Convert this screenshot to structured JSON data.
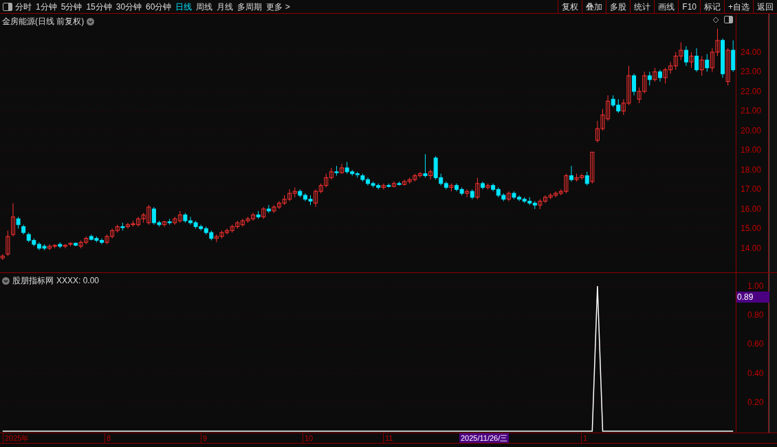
{
  "toolbar": {
    "periods": [
      {
        "label": "分时",
        "selected": false
      },
      {
        "label": "1分钟",
        "selected": false
      },
      {
        "label": "5分钟",
        "selected": false
      },
      {
        "label": "15分钟",
        "selected": false
      },
      {
        "label": "30分钟",
        "selected": false
      },
      {
        "label": "60分钟",
        "selected": false
      },
      {
        "label": "日线",
        "selected": true
      },
      {
        "label": "周线",
        "selected": false
      },
      {
        "label": "月线",
        "selected": false
      },
      {
        "label": "多周期",
        "selected": false
      },
      {
        "label": "更多 >",
        "selected": false
      }
    ],
    "actions": [
      "复权",
      "叠加",
      "多股",
      "统计",
      "画线",
      "F10",
      "标记",
      "+自选",
      "返回"
    ]
  },
  "main_chart": {
    "title": "金房能源(日线 前复权)",
    "chart_data": {
      "type": "candlestick",
      "ylim": [
        12.77,
        25.96
      ],
      "grid": true,
      "yticks": [
        {
          "value": 24,
          "label": "24.00"
        },
        {
          "value": 23,
          "label": "23.00"
        },
        {
          "value": 22,
          "label": "22.00"
        },
        {
          "value": 21,
          "label": "21.00"
        },
        {
          "value": 20,
          "label": "20.00"
        },
        {
          "value": 19,
          "label": "19.00"
        },
        {
          "value": 18,
          "label": "18.00"
        },
        {
          "value": 17,
          "label": "17.00"
        },
        {
          "value": 16,
          "label": "16.00"
        },
        {
          "value": 15,
          "label": "15.00"
        },
        {
          "value": 14,
          "label": "14.00"
        }
      ],
      "ohlc": [
        [
          13.5,
          13.7,
          13.4,
          13.6
        ],
        [
          13.7,
          14.9,
          13.6,
          14.6
        ],
        [
          14.7,
          16.3,
          14.6,
          15.6
        ],
        [
          15.5,
          15.6,
          15.0,
          15.2
        ],
        [
          15.1,
          15.2,
          14.7,
          14.8
        ],
        [
          14.7,
          14.8,
          14.3,
          14.4
        ],
        [
          14.4,
          14.5,
          14.1,
          14.2
        ],
        [
          14.2,
          14.3,
          13.9,
          14.0
        ],
        [
          14.1,
          14.2,
          13.9,
          14.0
        ],
        [
          14.0,
          14.2,
          13.9,
          14.1
        ],
        [
          14.1,
          14.2,
          14.0,
          14.15
        ],
        [
          14.2,
          14.3,
          14.0,
          14.1
        ],
        [
          14.1,
          14.2,
          14.0,
          14.15
        ],
        [
          14.2,
          14.3,
          14.1,
          14.25
        ],
        [
          14.25,
          14.3,
          14.1,
          14.15
        ],
        [
          14.1,
          14.4,
          14.0,
          14.3
        ],
        [
          14.3,
          14.6,
          14.2,
          14.5
        ],
        [
          14.6,
          14.7,
          14.4,
          14.45
        ],
        [
          14.5,
          14.6,
          14.3,
          14.4
        ],
        [
          14.4,
          14.5,
          14.2,
          14.3
        ],
        [
          14.3,
          14.7,
          14.2,
          14.6
        ],
        [
          14.6,
          15.0,
          14.5,
          14.9
        ],
        [
          14.9,
          15.2,
          14.8,
          15.1
        ],
        [
          15.1,
          15.3,
          14.9,
          15.05
        ],
        [
          15.1,
          15.3,
          15.0,
          15.2
        ],
        [
          15.2,
          15.4,
          15.1,
          15.25
        ],
        [
          15.2,
          15.6,
          15.1,
          15.5
        ],
        [
          15.5,
          15.8,
          15.3,
          15.7
        ],
        [
          15.3,
          16.2,
          15.2,
          16.1
        ],
        [
          16.0,
          16.1,
          15.2,
          15.3
        ],
        [
          15.3,
          15.4,
          15.1,
          15.2
        ],
        [
          15.2,
          15.4,
          15.1,
          15.35
        ],
        [
          15.35,
          15.5,
          15.2,
          15.3
        ],
        [
          15.3,
          15.6,
          15.2,
          15.5
        ],
        [
          15.4,
          15.9,
          15.3,
          15.7
        ],
        [
          15.7,
          15.8,
          15.3,
          15.4
        ],
        [
          15.4,
          15.6,
          15.2,
          15.3
        ],
        [
          15.3,
          15.4,
          15.0,
          15.1
        ],
        [
          15.1,
          15.2,
          14.9,
          15.0
        ],
        [
          15.0,
          15.1,
          14.7,
          14.8
        ],
        [
          14.8,
          14.9,
          14.4,
          14.5
        ],
        [
          14.5,
          14.7,
          14.3,
          14.6
        ],
        [
          14.6,
          14.9,
          14.5,
          14.8
        ],
        [
          14.8,
          15.0,
          14.7,
          14.9
        ],
        [
          14.9,
          15.2,
          14.8,
          15.1
        ],
        [
          15.1,
          15.4,
          15.0,
          15.3
        ],
        [
          15.2,
          15.5,
          15.1,
          15.4
        ],
        [
          15.4,
          15.6,
          15.3,
          15.5
        ],
        [
          15.5,
          15.8,
          15.4,
          15.7
        ],
        [
          15.7,
          15.9,
          15.5,
          15.6
        ],
        [
          15.6,
          16.1,
          15.5,
          16.0
        ],
        [
          16.0,
          16.2,
          15.8,
          15.9
        ],
        [
          15.9,
          16.2,
          15.8,
          16.1
        ],
        [
          16.1,
          16.4,
          16.0,
          16.3
        ],
        [
          16.3,
          16.7,
          16.2,
          16.5
        ],
        [
          16.5,
          17.0,
          16.4,
          16.8
        ],
        [
          16.8,
          17.1,
          16.6,
          16.9
        ],
        [
          16.9,
          17.0,
          16.6,
          16.7
        ],
        [
          16.7,
          16.8,
          16.4,
          16.5
        ],
        [
          16.5,
          16.7,
          16.2,
          16.4
        ],
        [
          16.3,
          17.0,
          16.1,
          16.9
        ],
        [
          16.9,
          17.3,
          16.8,
          17.2
        ],
        [
          17.2,
          17.8,
          17.1,
          17.6
        ],
        [
          17.6,
          18.1,
          17.5,
          17.9
        ],
        [
          17.9,
          18.2,
          17.7,
          17.85
        ],
        [
          17.85,
          18.3,
          17.8,
          18.1
        ],
        [
          18.1,
          18.4,
          17.8,
          17.9
        ],
        [
          17.9,
          18.0,
          17.7,
          17.8
        ],
        [
          17.8,
          17.9,
          17.6,
          17.75
        ],
        [
          17.7,
          17.8,
          17.4,
          17.5
        ],
        [
          17.5,
          17.6,
          17.2,
          17.3
        ],
        [
          17.3,
          17.4,
          17.1,
          17.2
        ],
        [
          17.2,
          17.3,
          17.0,
          17.1
        ],
        [
          17.1,
          17.3,
          17.0,
          17.2
        ],
        [
          17.2,
          17.3,
          17.1,
          17.15
        ],
        [
          17.15,
          17.4,
          17.1,
          17.3
        ],
        [
          17.3,
          17.4,
          17.2,
          17.25
        ],
        [
          17.25,
          17.5,
          17.2,
          17.4
        ],
        [
          17.4,
          17.6,
          17.3,
          17.5
        ],
        [
          17.5,
          17.8,
          17.4,
          17.7
        ],
        [
          17.7,
          17.9,
          17.6,
          17.8
        ],
        [
          17.8,
          18.8,
          17.6,
          17.7
        ],
        [
          17.7,
          18.0,
          17.5,
          17.9
        ],
        [
          18.6,
          18.7,
          17.5,
          17.6
        ],
        [
          17.6,
          17.8,
          17.2,
          17.3
        ],
        [
          17.3,
          17.4,
          17.0,
          17.1
        ],
        [
          17.1,
          17.3,
          16.9,
          17.2
        ],
        [
          17.2,
          17.3,
          16.9,
          17.0
        ],
        [
          17.0,
          17.1,
          16.7,
          16.8
        ],
        [
          16.8,
          17.0,
          16.6,
          16.9
        ],
        [
          16.9,
          17.0,
          16.5,
          16.6
        ],
        [
          16.6,
          17.6,
          16.5,
          17.3
        ],
        [
          17.3,
          17.4,
          17.0,
          17.1
        ],
        [
          17.1,
          17.3,
          17.0,
          17.2
        ],
        [
          17.2,
          17.3,
          16.9,
          17.0
        ],
        [
          17.0,
          17.1,
          16.6,
          16.7
        ],
        [
          16.7,
          16.8,
          16.4,
          16.5
        ],
        [
          16.5,
          16.9,
          16.4,
          16.8
        ],
        [
          16.8,
          16.9,
          16.5,
          16.6
        ],
        [
          16.6,
          16.7,
          16.4,
          16.5
        ],
        [
          16.5,
          16.6,
          16.3,
          16.4
        ],
        [
          16.4,
          16.6,
          16.2,
          16.3
        ],
        [
          16.3,
          16.4,
          16.0,
          16.2
        ],
        [
          16.2,
          16.5,
          16.0,
          16.4
        ],
        [
          16.4,
          16.7,
          16.3,
          16.6
        ],
        [
          16.6,
          16.8,
          16.5,
          16.7
        ],
        [
          16.7,
          16.9,
          16.6,
          16.8
        ],
        [
          16.8,
          17.0,
          16.7,
          16.9
        ],
        [
          16.9,
          17.8,
          16.8,
          17.7
        ],
        [
          17.7,
          18.2,
          17.4,
          17.5
        ],
        [
          17.5,
          17.8,
          17.4,
          17.6
        ],
        [
          17.6,
          17.8,
          17.5,
          17.7
        ],
        [
          17.7,
          17.9,
          17.2,
          17.3
        ],
        [
          17.4,
          18.9,
          17.3,
          18.9
        ],
        [
          19.5,
          20.5,
          19.4,
          20.1
        ],
        [
          20.1,
          21.1,
          20.0,
          20.8
        ],
        [
          20.6,
          21.8,
          20.5,
          21.5
        ],
        [
          21.6,
          21.8,
          21.2,
          21.3
        ],
        [
          21.3,
          21.6,
          20.9,
          21.0
        ],
        [
          21.0,
          21.6,
          20.8,
          21.4
        ],
        [
          21.4,
          23.3,
          21.3,
          22.8
        ],
        [
          22.8,
          22.9,
          21.8,
          22.0
        ],
        [
          21.6,
          22.2,
          21.4,
          22.0
        ],
        [
          22.0,
          23.0,
          21.9,
          22.8
        ],
        [
          22.8,
          23.0,
          22.3,
          22.6
        ],
        [
          22.6,
          23.2,
          22.5,
          23.0
        ],
        [
          23.0,
          23.1,
          22.5,
          22.7
        ],
        [
          22.7,
          23.2,
          22.4,
          23.1
        ],
        [
          23.1,
          23.5,
          22.9,
          23.3
        ],
        [
          23.3,
          24.0,
          23.1,
          23.8
        ],
        [
          23.8,
          24.5,
          23.6,
          24.1
        ],
        [
          24.1,
          24.3,
          23.3,
          23.5
        ],
        [
          23.5,
          24.0,
          23.2,
          23.8
        ],
        [
          23.8,
          24.2,
          23.0,
          23.1
        ],
        [
          23.1,
          23.8,
          22.8,
          23.6
        ],
        [
          23.6,
          23.9,
          23.0,
          23.2
        ],
        [
          23.2,
          24.2,
          23.0,
          24.0
        ],
        [
          24.0,
          25.2,
          23.8,
          24.6
        ],
        [
          24.6,
          24.7,
          22.7,
          22.9
        ],
        [
          22.5,
          24.2,
          22.3,
          24.1
        ],
        [
          24.1,
          24.6,
          23.0,
          23.1
        ]
      ]
    }
  },
  "indicator": {
    "name": "股朋指标网",
    "reading": ": 0.00",
    "current_value": "0.89",
    "chart_data": {
      "type": "line",
      "ylim": [
        0,
        1
      ],
      "grid": true,
      "yticks": [
        {
          "value": 1,
          "label": "1.00"
        },
        {
          "value": 0.8,
          "label": "0.80"
        },
        {
          "value": 0.6,
          "label": "0.60"
        },
        {
          "value": 0.4,
          "label": "0.40"
        },
        {
          "value": 0.2,
          "label": "0.20"
        }
      ],
      "series": [
        {
          "name": "XXXX",
          "color": "#ffffff",
          "values": [
            0,
            0,
            0,
            0,
            0,
            0,
            0,
            0,
            0,
            0,
            0,
            0,
            0,
            0,
            0,
            0,
            0,
            0,
            0,
            0,
            0,
            0,
            0,
            0,
            0,
            0,
            0,
            0,
            0,
            0,
            0,
            0,
            0,
            0,
            0,
            0,
            0,
            0,
            0,
            0,
            0,
            0,
            0,
            0,
            0,
            0,
            0,
            0,
            0,
            0,
            0,
            0,
            0,
            0,
            0,
            0,
            0,
            0,
            0,
            0,
            0,
            0,
            0,
            0,
            0,
            0,
            0,
            0,
            0,
            0,
            0,
            0,
            0,
            0,
            0,
            0,
            0,
            0,
            0,
            0,
            0,
            0,
            0,
            0,
            0,
            0,
            0,
            0,
            0,
            0,
            0,
            0,
            0,
            0,
            0,
            0,
            0,
            0,
            0,
            0,
            0,
            0,
            0,
            0,
            0,
            0,
            0,
            0,
            0,
            0,
            0,
            0,
            0,
            0,
            1,
            0,
            0,
            0,
            0,
            0,
            0,
            0,
            0,
            0,
            0,
            0,
            0,
            0,
            0,
            0,
            0,
            0,
            0,
            0,
            0,
            0,
            0,
            0,
            0,
            0,
            0
          ]
        }
      ]
    }
  },
  "date_axis": [
    {
      "label": "2025年",
      "selected": false
    },
    {
      "label": "8",
      "selected": false
    },
    {
      "label": "9",
      "selected": false
    },
    {
      "label": "10",
      "selected": false
    },
    {
      "label": "11",
      "selected": false
    },
    {
      "label": "2025/11/26/三",
      "selected": true
    },
    {
      "label": "1",
      "selected": false
    }
  ]
}
